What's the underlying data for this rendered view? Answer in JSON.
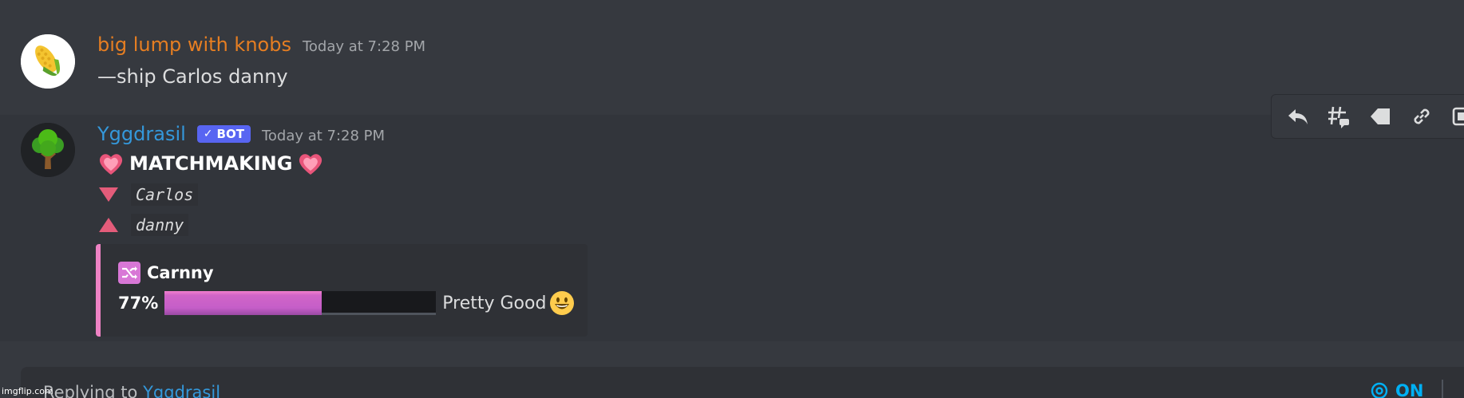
{
  "messages": [
    {
      "username": "big lump with knobs",
      "timestamp": "Today at 7:28 PM",
      "text": "—ship Carlos danny",
      "avatar_icon": "corn-icon",
      "username_color": "#e67e22"
    },
    {
      "username": "Yggdrasil",
      "timestamp": "Today at 7:28 PM",
      "bot_tag": "BOT",
      "avatar_icon": "tree-icon",
      "username_color": "#3498db",
      "title": "MATCHMAKING",
      "person_one": "Carlos",
      "person_two": "danny",
      "embed": {
        "title": "Carnny",
        "percent_label": "77%",
        "percent_value": 77,
        "verdict": "Pretty Good",
        "accent_color": "#ee82c4"
      }
    }
  ],
  "toolbar": {
    "items": [
      "reply-icon",
      "thread-icon",
      "tag-icon",
      "link-icon",
      "more-icon"
    ]
  },
  "composer": {
    "reply_prefix": "Replying to",
    "reply_target": "Yggdrasil",
    "mention_label": "ON"
  },
  "watermark": "imgflip.com"
}
